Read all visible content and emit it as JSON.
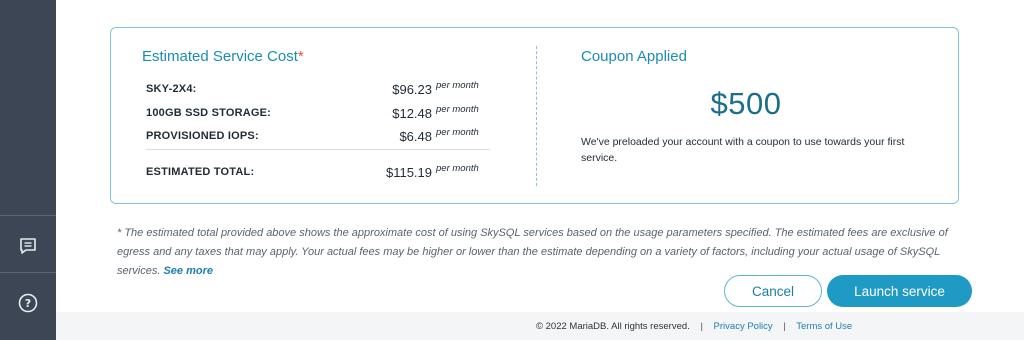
{
  "sidebar": {
    "chat_icon": "chat-icon",
    "help_icon": "help-icon"
  },
  "estimate": {
    "title": "Estimated Service Cost",
    "asterisk": "*",
    "rows": [
      {
        "label": "SKY-2X4:",
        "amount": "$96.23",
        "period": "per month"
      },
      {
        "label": "100GB SSD STORAGE:",
        "amount": "$12.48",
        "period": "per month"
      },
      {
        "label": "PROVISIONED IOPS:",
        "amount": "$6.48",
        "period": "per month"
      }
    ],
    "total": {
      "label": "ESTIMATED TOTAL:",
      "amount": "$115.19",
      "period": "per month"
    }
  },
  "coupon": {
    "title": "Coupon Applied",
    "amount": "$500",
    "description": "We've preloaded your account with a coupon to use towards your first service."
  },
  "disclaimer": {
    "text": "* The estimated total provided above shows the approximate cost of using SkySQL services based on the usage parameters specified. The estimated fees are exclusive of egress and any taxes that may apply. Your actual fees may be higher or lower than the estimate depending on a variety of factors, including your actual usage of SkySQL services.",
    "link": "See more"
  },
  "actions": {
    "cancel": "Cancel",
    "launch": "Launch service"
  },
  "footer": {
    "copyright": "© 2022 MariaDB. All rights reserved.",
    "separator": "|",
    "privacy": "Privacy Policy",
    "terms": "Terms of Use"
  },
  "colors": {
    "sidebar": "#3c4654",
    "accent": "#1f9ac4",
    "card_border": "#7ec8dc",
    "asterisk": "#e0533c"
  }
}
